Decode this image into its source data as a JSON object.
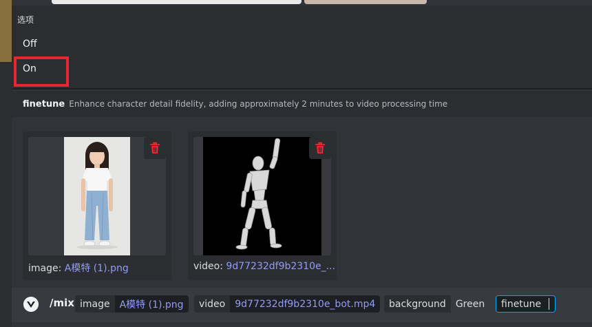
{
  "popup": {
    "title": "选项",
    "options": [
      {
        "label": "Off",
        "highlighted": false
      },
      {
        "label": "On",
        "highlighted": true
      }
    ]
  },
  "description": {
    "name": "finetune",
    "text": "Enhance character detail fidelity, adding approximately 2 minutes to video processing time"
  },
  "attachments": [
    {
      "kind_label": "image:",
      "filename": "A模特 (1).png",
      "icon": "trash-icon"
    },
    {
      "kind_label": "video:",
      "filename": "9d77232df9b2310e_...",
      "icon": "trash-icon"
    }
  ],
  "command": {
    "name": "/mix",
    "bot_icon": "bot-avatar-icon",
    "params": [
      {
        "key": "image",
        "value": "A模特 (1).png"
      },
      {
        "key": "video",
        "value": "9d77232df9b2310e_bot.mp4"
      },
      {
        "key": "background",
        "value": "Green"
      },
      {
        "key": "finetune",
        "value": ""
      }
    ]
  },
  "colors": {
    "background": "#313338",
    "panel": "#2b2d31",
    "link": "#949cf7",
    "danger": "#e8262f",
    "focus": "#00a8fc"
  }
}
